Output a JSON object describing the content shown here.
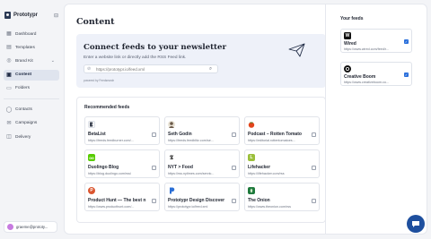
{
  "app": {
    "name": "Prototypr",
    "collapse_icon": "collapse-icon"
  },
  "sidebar": {
    "items": [
      {
        "label": "Dashboard",
        "icon": "dashboard-icon",
        "active": false
      },
      {
        "label": "Templates",
        "icon": "templates-icon",
        "active": false
      },
      {
        "label": "Brand Kit",
        "icon": "brand-kit-icon",
        "active": false,
        "expandable": true
      },
      {
        "label": "Content",
        "icon": "content-icon",
        "active": true
      },
      {
        "label": "Folders",
        "icon": "folders-icon",
        "active": false
      }
    ],
    "items2": [
      {
        "label": "Contacts",
        "icon": "contacts-icon"
      },
      {
        "label": "Campaigns",
        "icon": "campaigns-icon"
      },
      {
        "label": "Delivery",
        "icon": "delivery-icon"
      }
    ],
    "user": {
      "email": "graeme@prototy..."
    }
  },
  "content": {
    "title": "Content",
    "connect": {
      "title": "Connect feeds to your newsletter",
      "description": "Enter a website link or directly add the RSS Feed link.",
      "input_placeholder": "https://prototypr.io/feed.xml",
      "powered_by": "powered by Feedsearch"
    },
    "recommended": {
      "title": "Recommended feeds",
      "feeds": [
        {
          "name": "BetaList",
          "url": "https://feeds.feedburner.com/...",
          "logo_color": "#ffffff",
          "logo_text": ""
        },
        {
          "name": "Seth Godin",
          "url": "https://feeds.feedblitz.com/se...",
          "logo_color": "#e9e3d6",
          "logo_text": ""
        },
        {
          "name": "Podcast – Rotten Tomato",
          "url": "https://editorial.rottentomatoes...",
          "logo_color": "#e2451c",
          "logo_text": ""
        },
        {
          "name": "Duolingo Blog",
          "url": "https://blog.duolingo.com/rss/",
          "logo_color": "#58cc02",
          "logo_text": "oo"
        },
        {
          "name": "NYT > Food",
          "url": "https://rss.nytimes.com/servic...",
          "logo_color": "#ffffff",
          "logo_text": "𝕿"
        },
        {
          "name": "Lifehacker",
          "url": "https://lifehacker.com/rss",
          "logo_color": "#9bbf3b",
          "logo_text": "L"
        },
        {
          "name": "Product Hunt — The best n",
          "url": "https://www.producthunt.com/...",
          "logo_color": "#da552f",
          "logo_text": "P"
        },
        {
          "name": "Prototypr Design Discover",
          "url": "https://prototypr.io/feed.xml",
          "logo_color": "#ffffff",
          "logo_text": ""
        },
        {
          "name": "The Onion",
          "url": "https://www.theonion.com/rss",
          "logo_color": "#1e7a3c",
          "logo_text": ""
        }
      ]
    }
  },
  "your_feeds": {
    "title": "Your feeds",
    "feeds": [
      {
        "name": "Wired",
        "url": "https://www.wired.com/feed/r...",
        "logo_color": "#111111",
        "logo_text": "W",
        "checked": true
      },
      {
        "name": "Creative Boom",
        "url": "https://www.creativeboom.co...",
        "logo_color": "#111111",
        "logo_text": "",
        "checked": true
      }
    ]
  },
  "chat": {
    "icon": "chat-icon"
  }
}
